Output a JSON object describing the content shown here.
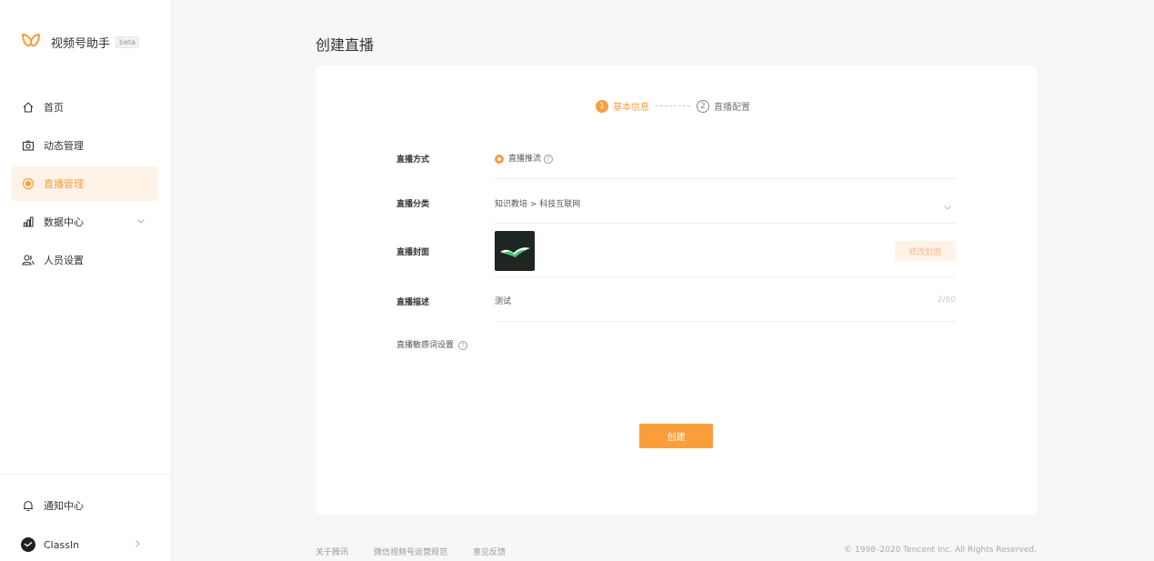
{
  "brand": {
    "name": "视频号助手",
    "tag": "beta"
  },
  "nav": [
    {
      "label": "首页",
      "icon": "home-icon"
    },
    {
      "label": "动态管理",
      "icon": "camera-icon"
    },
    {
      "label": "直播管理",
      "icon": "live-icon",
      "active": true
    },
    {
      "label": "数据中心",
      "icon": "chart-icon",
      "expandable": true
    },
    {
      "label": "人员设置",
      "icon": "users-icon"
    }
  ],
  "bottom": {
    "notifications": "通知中心",
    "account": "ClassIn"
  },
  "page": {
    "title": "创建直播"
  },
  "steps": [
    {
      "num": "1",
      "label": "基本信息"
    },
    {
      "num": "2",
      "label": "直播配置"
    }
  ],
  "form": {
    "mode": {
      "label": "直播方式",
      "value": "直播推流",
      "help": "?"
    },
    "category": {
      "label": "直播分类",
      "value": "知识教培 > 科技互联网"
    },
    "cover": {
      "label": "直播封面",
      "button": "修改封面"
    },
    "description": {
      "label": "直播描述",
      "value": "测试",
      "counter": "2/60"
    },
    "sensitive": {
      "label": "直播敏感词设置",
      "help": "?"
    }
  },
  "actions": {
    "create": "创建"
  },
  "footer": {
    "links": [
      "关于腾讯",
      "微信视频号运营规范",
      "意见反馈"
    ],
    "copyright": "© 1998–2020 Tencent Inc. All Rights Reserved."
  },
  "colors": {
    "accent": "#fa9d3b",
    "accent_light": "#fff3e8"
  }
}
